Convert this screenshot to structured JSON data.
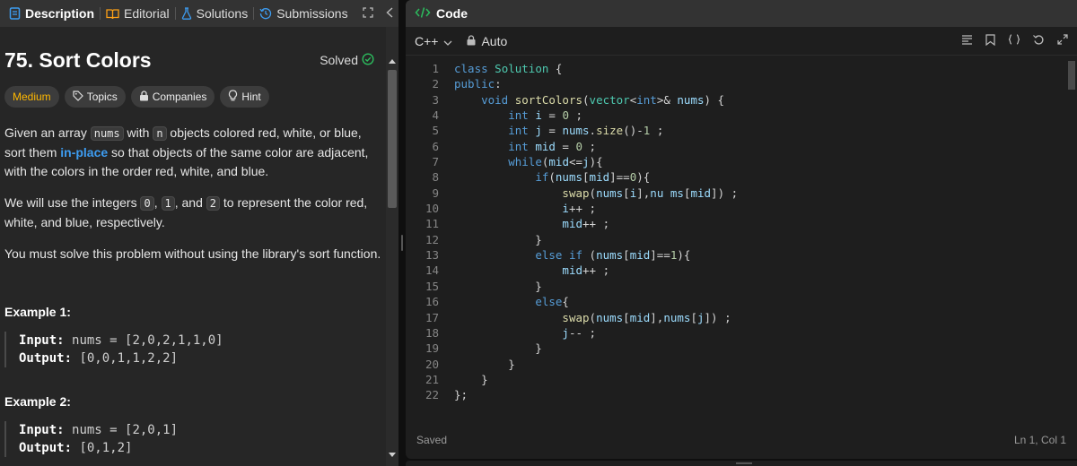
{
  "tabs": [
    {
      "label": "Description",
      "icon": "document-icon",
      "active": true
    },
    {
      "label": "Editorial",
      "icon": "book-icon"
    },
    {
      "label": "Solutions",
      "icon": "flask-icon"
    },
    {
      "label": "Submissions",
      "icon": "history-icon"
    }
  ],
  "problem": {
    "title": "75. Sort Colors",
    "status": "Solved",
    "tags": {
      "difficulty": "Medium",
      "topics": "Topics",
      "companies": "Companies",
      "hint": "Hint"
    },
    "description": {
      "p1_a": "Given an array ",
      "p1_code1": "nums",
      "p1_b": " with ",
      "p1_code2": "n",
      "p1_c": " objects colored red, white, or blue, sort them ",
      "p1_link": "in-place",
      "p1_d": " so that objects of the same color are adjacent, with the colors in the order red, white, and blue.",
      "p2_a": "We will use the integers ",
      "p2_c0": "0",
      "p2_b": ", ",
      "p2_c1": "1",
      "p2_c": ", and ",
      "p2_c2": "2",
      "p2_d": " to represent the color red, white, and blue, respectively.",
      "p3": "You must solve this problem without using the library's sort function."
    },
    "examples": [
      {
        "title": "Example 1:",
        "input_label": "Input:",
        "input": "nums = [2,0,2,1,1,0]",
        "output_label": "Output:",
        "output": "[0,0,1,1,2,2]"
      },
      {
        "title": "Example 2:",
        "input_label": "Input:",
        "input": "nums = [2,0,1]",
        "output_label": "Output:",
        "output": "[0,1,2]"
      }
    ]
  },
  "editor": {
    "header": "Code",
    "language": "C++",
    "mode": "Auto",
    "save_status": "Saved",
    "cursor": "Ln 1, Col 1",
    "lines": [
      "1",
      "2",
      "3",
      "4",
      "5",
      "6",
      "7",
      "8",
      "9",
      "10",
      "11",
      "12",
      "13",
      "14",
      "15",
      "16",
      "17",
      "18",
      "19",
      "20",
      "21",
      "22"
    ]
  },
  "colors": {
    "accent_green": "#2cbb5d",
    "medium": "#ffb800",
    "link": "#3d9cf0",
    "code_header_icon": "#ffb800"
  }
}
